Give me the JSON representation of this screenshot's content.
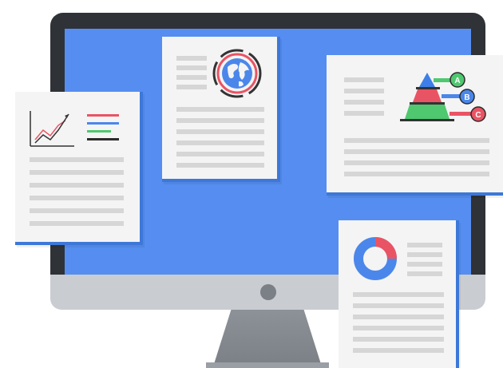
{
  "illustration": {
    "screen_color": "#558ef0",
    "bezel_color": "#2f3236",
    "chin_color": "#c9ccd1",
    "doc_accent": "#3d78d8",
    "icons": [
      "line-chart-icon",
      "globe-icon",
      "pyramid-chart-icon",
      "donut-chart-icon"
    ]
  },
  "pyramid": {
    "labels": [
      "A",
      "B",
      "C"
    ],
    "colors": [
      "#3d7fe6",
      "#e95464",
      "#4fc86f"
    ]
  },
  "line_chart": {
    "legend_colors": [
      "#e95464",
      "#4b87ea",
      "#4fc86f",
      "#2b2b2b"
    ]
  },
  "donut": {
    "colors": [
      "#4b87ea",
      "#e95464"
    ],
    "red_fraction": 0.25
  }
}
